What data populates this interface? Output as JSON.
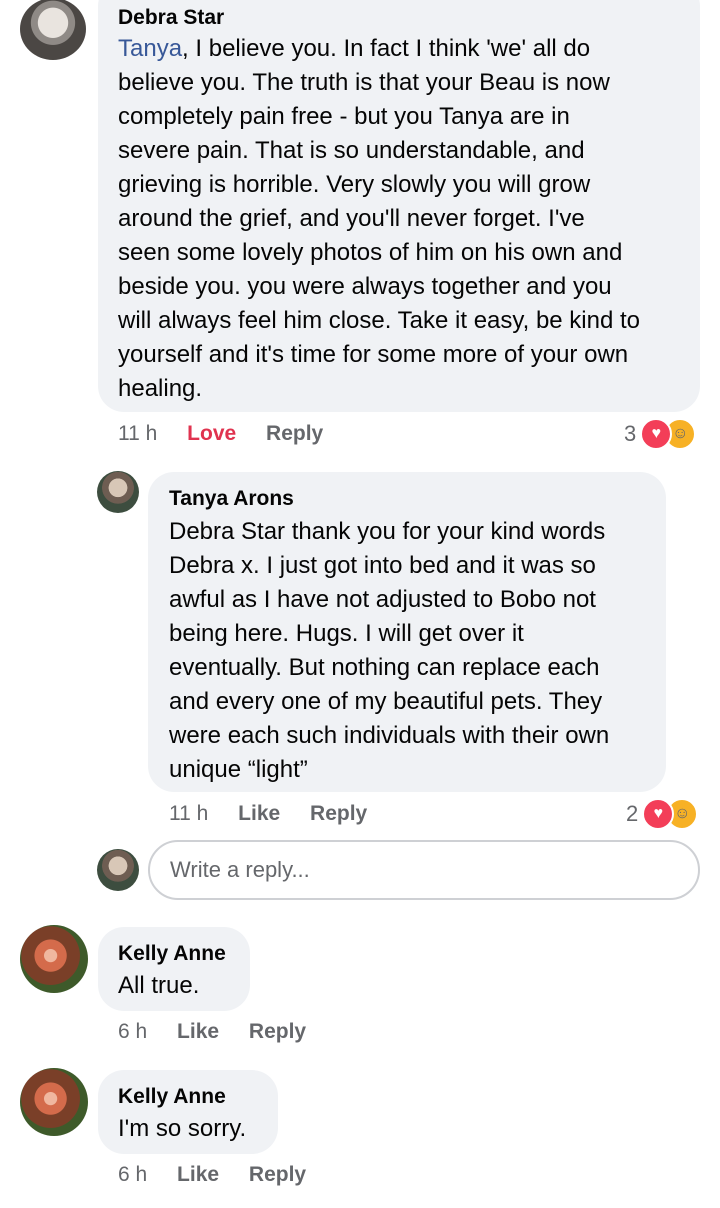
{
  "comments": [
    {
      "author": "Debra Star",
      "mention": "Tanya",
      "text_lines": [
        ", I believe you. In fact I think 'we' all do",
        "believe you. The truth is that your Beau is now",
        "completely pain free  - but you Tanya are in",
        "severe pain. That is so understandable, and",
        "grieving is horrible. Very slowly you will grow",
        "around the grief, and you'll never forget. I've",
        "seen some lovely photos of him on his own and",
        "beside you. you were always together and you",
        "will always feel him close. Take it easy, be kind to",
        "yourself and it's time for some more of your own",
        "healing."
      ],
      "time": "11 h",
      "reaction_label": "Love",
      "reply_label": "Reply",
      "reaction_count": "3"
    },
    {
      "author": "Tanya Arons",
      "text_lines": [
        "Debra Star thank you for your kind words",
        "Debra x. I just got into bed and it was so",
        "awful as I have not adjusted to Bobo not",
        "being here. Hugs.  I will get over it",
        "eventually.  But nothing can replace each",
        "and every one of my beautiful pets.  They",
        "were each such individuals with their own",
        "unique “light”"
      ],
      "time": "11 h",
      "like_label": "Like",
      "reply_label": "Reply",
      "reaction_count": "2"
    },
    {
      "author": "Kelly Anne",
      "text": "All true.",
      "time": "6 h",
      "like_label": "Like",
      "reply_label": "Reply"
    },
    {
      "author": "Kelly Anne",
      "text": "I'm so sorry.",
      "time": "6 h",
      "like_label": "Like",
      "reply_label": "Reply"
    }
  ],
  "reply_input": {
    "placeholder": "Write a reply..."
  },
  "icons": {
    "love_reaction": "heart-icon",
    "care_reaction": "care-icon"
  },
  "colors": {
    "bubble": "#f0f2f5",
    "love": "#e0334f",
    "mention": "#385898",
    "meta": "#65676b"
  }
}
